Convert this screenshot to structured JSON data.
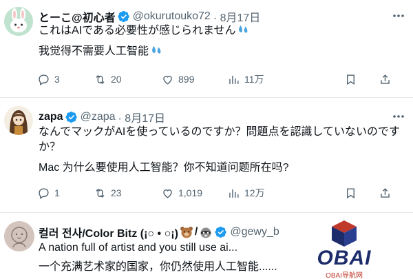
{
  "tweets": [
    {
      "display_name": "とーこ@初心者",
      "handle": "@okurutouko72",
      "date": "· 8月17日",
      "lines": [
        "これはAIである必要性が感じられません",
        "我觉得不需要人工智能"
      ],
      "reply_count": "3",
      "retweet_count": "20",
      "like_count": "899",
      "view_count": "11万"
    },
    {
      "display_name": "zapa",
      "handle": "@zapa",
      "date": "· 8月17日",
      "lines": [
        "なんでマックがAIを使っているのですか？問題点を認識していないのです",
        "か？",
        "Mac 为什么要使用人工智能？你不知道问题所在吗?"
      ],
      "reply_count": "1",
      "retweet_count": "23",
      "like_count": "1,019",
      "view_count": "12万"
    },
    {
      "display_name": "컬러 전사/Color Bitz (¡○ • ○¡)",
      "handle": "@gewy_b",
      "lines": [
        "A nation full of artist and you still use ai...",
        "一个充满艺术家的国家，你仍然使用人工智能......"
      ]
    }
  ],
  "watermark": {
    "word": "OBAI",
    "subtitle": "OBAI导航网"
  },
  "colors": {
    "text": "#0f1419",
    "muted": "#536471",
    "verified": "#1d9bf0",
    "divider": "#e6e9ec",
    "logo_blue": "#1d2c6b",
    "logo_red": "#c0392b"
  },
  "icons": [
    "verified-icon",
    "more-icon",
    "sweat-drops-icon",
    "reply-icon",
    "retweet-icon",
    "like-icon",
    "views-icon",
    "bookmark-icon",
    "share-icon",
    "bear-emoji-icon",
    "raccoon-emoji-icon"
  ]
}
